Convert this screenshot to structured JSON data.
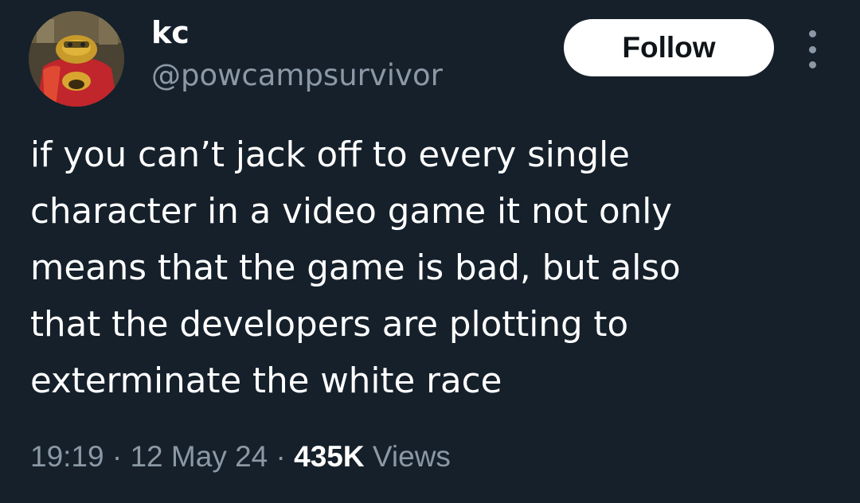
{
  "author": {
    "display_name": "kc",
    "handle": "@powcampsurvivor",
    "avatar_icon": "avatar-image"
  },
  "header": {
    "follow_label": "Follow",
    "more_icon": "more-options-icon"
  },
  "tweet": {
    "text": "if you can’t jack off to every single\ncharacter in a video game it not only\nmeans that the game is bad, but also\nthat the developers are plotting to\nexterminate the white race"
  },
  "meta": {
    "time": "19:19",
    "separator": " · ",
    "date": "12 May 24",
    "views_count": "435K",
    "views_label": " Views"
  },
  "colors": {
    "background": "#15202b",
    "text": "#ffffff",
    "secondary_text": "#8b98a5",
    "button_bg": "#ffffff",
    "button_text": "#0f1419"
  }
}
